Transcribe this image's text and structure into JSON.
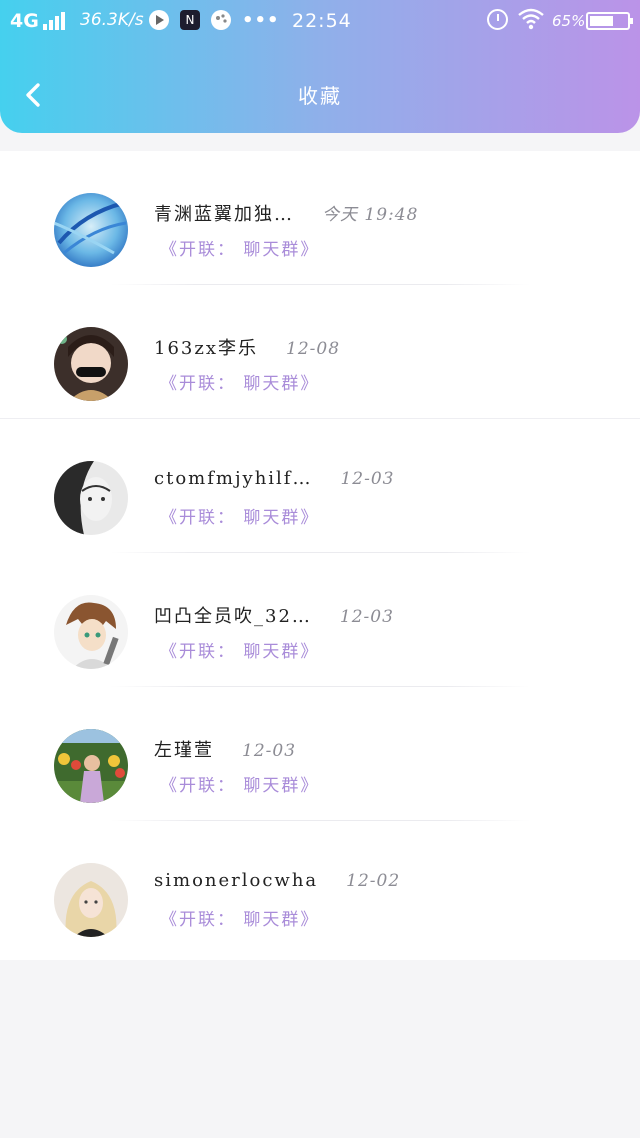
{
  "status_bar": {
    "network": "4G",
    "speed": "36.3K/s",
    "app_icon_1": "N",
    "dots": "•••",
    "time": "22:54",
    "battery_pct": "65%",
    "battery_level": 0.65
  },
  "header": {
    "title": "收藏",
    "back_icon": "chevron-left-icon"
  },
  "favorites": [
    {
      "name": "青渊蓝翼加独…",
      "date": "今天 19:48",
      "group": "《开联： 聊天群》"
    },
    {
      "name": "163zx李乐",
      "date": "12-08",
      "group": "《开联： 聊天群》"
    },
    {
      "name": "ctomfmjyhilf…",
      "date": "12-03",
      "group": "《开联： 聊天群》"
    },
    {
      "name": "凹凸全员吹_32…",
      "date": "12-03",
      "group": "《开联： 聊天群》"
    },
    {
      "name": "左瑾萱",
      "date": "12-03",
      "group": "《开联： 聊天群》"
    },
    {
      "name": "simonerlocwha",
      "date": "12-02",
      "group": "《开联： 聊天群》"
    }
  ],
  "colors": {
    "header_gradient": [
      "#45d0ee",
      "#8fb0ea",
      "#bb93e8"
    ],
    "group_text": "#a98cd9",
    "date_text": "#8c8c94"
  }
}
